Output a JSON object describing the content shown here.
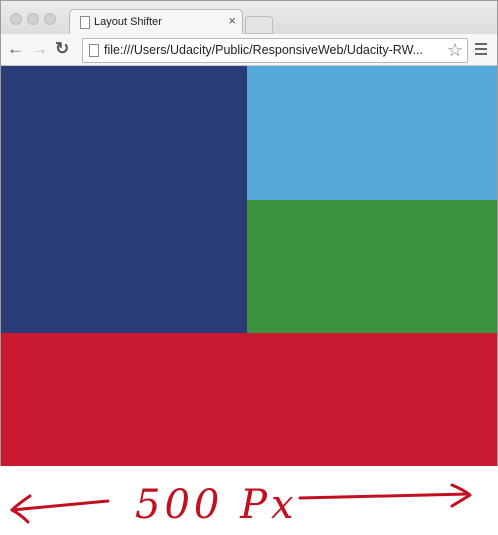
{
  "tab": {
    "title": "Layout Shifter",
    "close_glyph": "×"
  },
  "toolbar": {
    "back_glyph": "←",
    "forward_glyph": "→",
    "reload_glyph": "↻",
    "star_glyph": "☆"
  },
  "address": {
    "url": "file:///Users/Udacity/Public/ResponsiveWeb/Udacity-RW..."
  },
  "boxes": [
    {
      "name": "dark-blue",
      "color": "#2a3c78"
    },
    {
      "name": "light-blue",
      "color": "#54a9d9"
    },
    {
      "name": "green",
      "color": "#3c9440"
    },
    {
      "name": "red",
      "color": "#c91a31"
    }
  ],
  "annotation": {
    "text": "500 Px",
    "color": "#c21020"
  },
  "icons": [
    "page-icon",
    "close-icon",
    "back-icon",
    "forward-icon",
    "reload-icon",
    "star-icon",
    "menu-icon"
  ]
}
